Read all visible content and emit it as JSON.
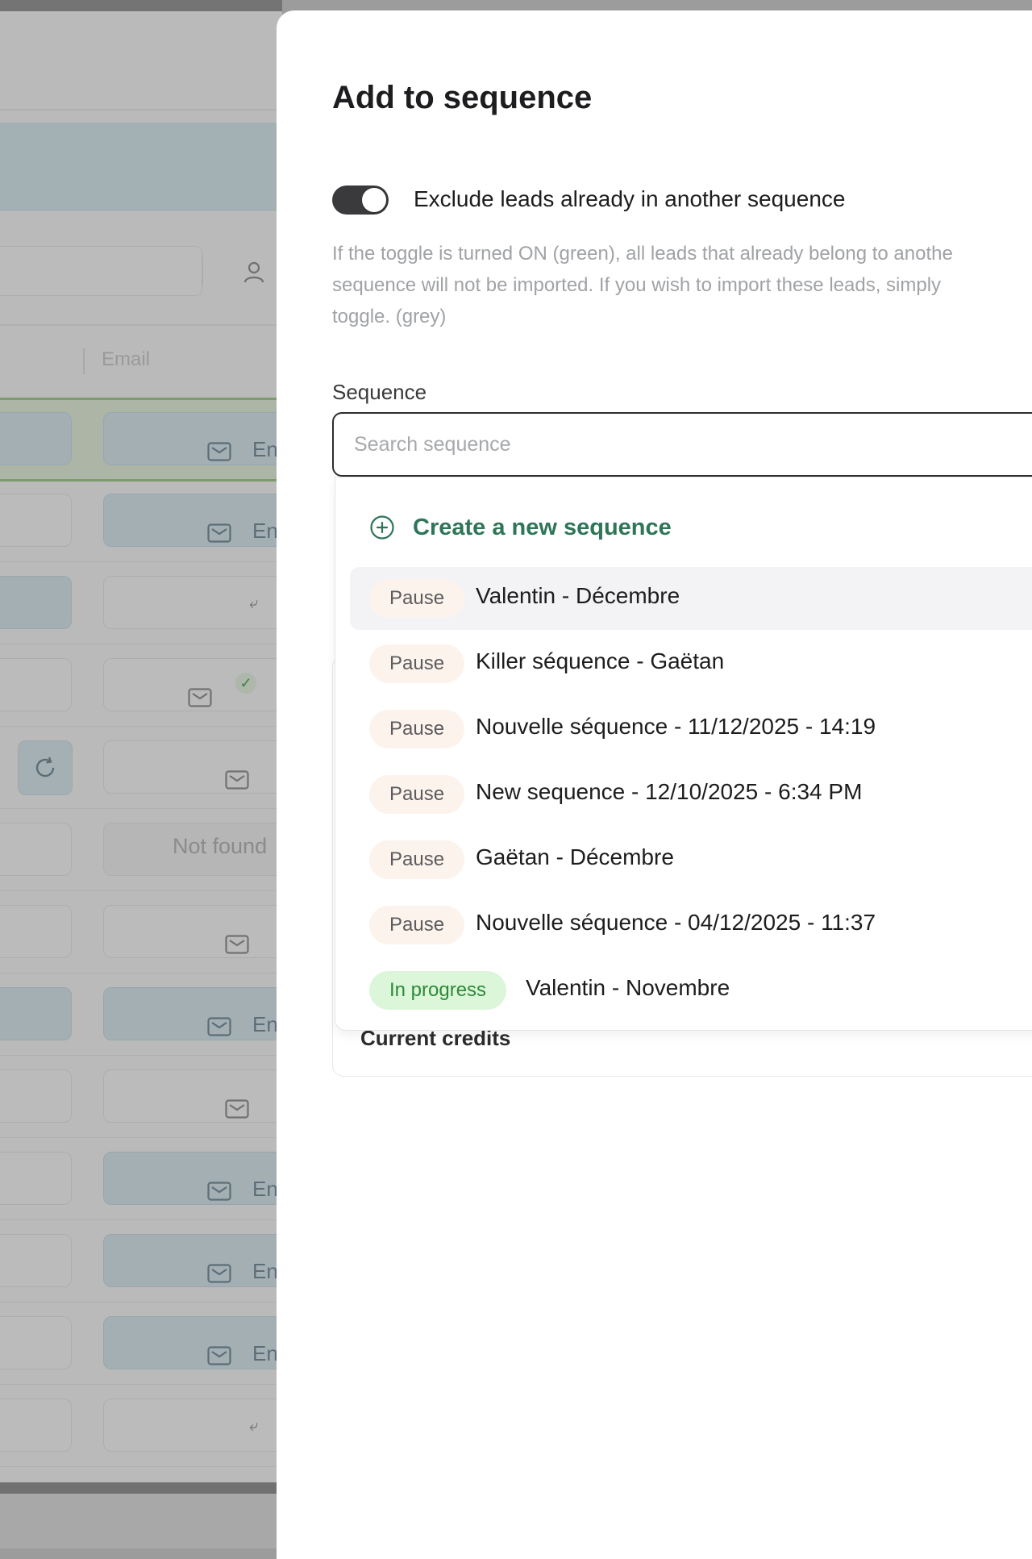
{
  "background": {
    "column_header": "Email",
    "cell_email_prefix": "En",
    "not_found_text": "Not found"
  },
  "modal": {
    "title": "Add to sequence",
    "toggle": {
      "label": "Exclude leads already in another sequence",
      "state": "on"
    },
    "help_text": {
      "line1": "If the toggle is turned ON (green), all leads that already belong to anothe",
      "line2": "sequence will not be imported. If you wish to import these leads, simply",
      "line3": "toggle. (grey)"
    },
    "sequence_field": {
      "label": "Sequence",
      "placeholder": "Search sequence",
      "value": ""
    },
    "dropdown": {
      "create_label": "Create a new sequence",
      "items": [
        {
          "status": "Pause",
          "name": "Valentin - Décembre"
        },
        {
          "status": "Pause",
          "name": "Killer séquence - Gaëtan"
        },
        {
          "status": "Pause",
          "name": "Nouvelle séquence - 11/12/2025 - 14:19"
        },
        {
          "status": "Pause",
          "name": "New sequence - 12/10/2025 - 6:34 PM"
        },
        {
          "status": "Pause",
          "name": "Gaëtan - Décembre"
        },
        {
          "status": "Pause",
          "name": "Nouvelle séquence - 04/12/2025 - 11:37"
        },
        {
          "status": "In progress",
          "name": "Valentin - Novembre"
        }
      ]
    },
    "credits_label": "Current credits"
  },
  "colors": {
    "accent_green": "#2f7558",
    "pause_badge_bg": "#fcf3ec",
    "progress_badge_bg": "#dcf6d9",
    "progress_badge_text": "#2e8a3a",
    "toggle_on": "#3a3a3c"
  }
}
